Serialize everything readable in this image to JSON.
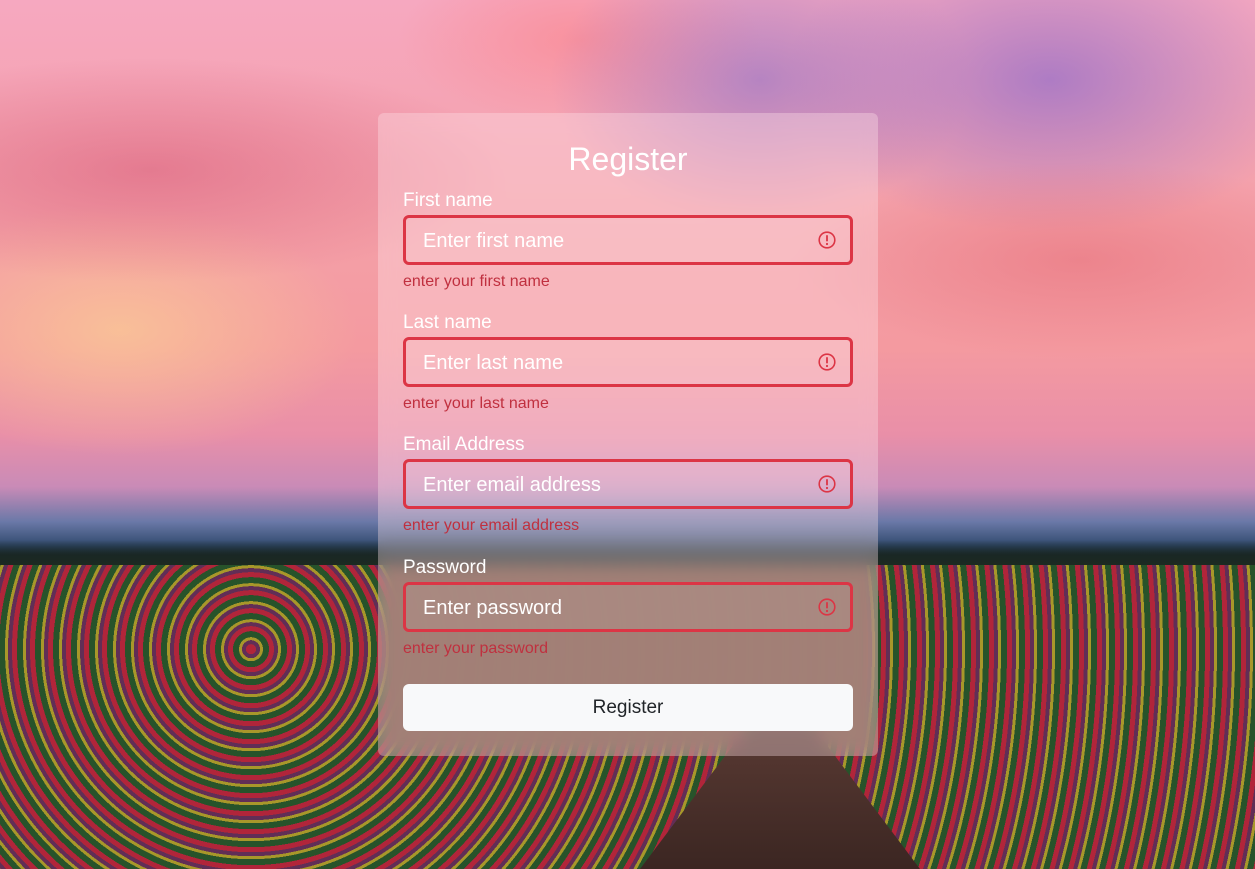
{
  "form": {
    "title": "Register",
    "submit_label": "Register",
    "fields": [
      {
        "label": "First name",
        "placeholder": "Enter first name",
        "value": "",
        "error": "enter your first name"
      },
      {
        "label": "Last name",
        "placeholder": "Enter last name",
        "value": "",
        "error": "enter your last name"
      },
      {
        "label": "Email Address",
        "placeholder": "Enter email address",
        "value": "",
        "error": "enter your email address"
      },
      {
        "label": "Password",
        "placeholder": "Enter password",
        "value": "",
        "error": "enter your password"
      }
    ]
  },
  "colors": {
    "error": "#dc3545",
    "button_bg": "#f8f9fa",
    "label": "#ffffff"
  },
  "icons": {
    "field_status": "exclamation-circle-icon"
  }
}
